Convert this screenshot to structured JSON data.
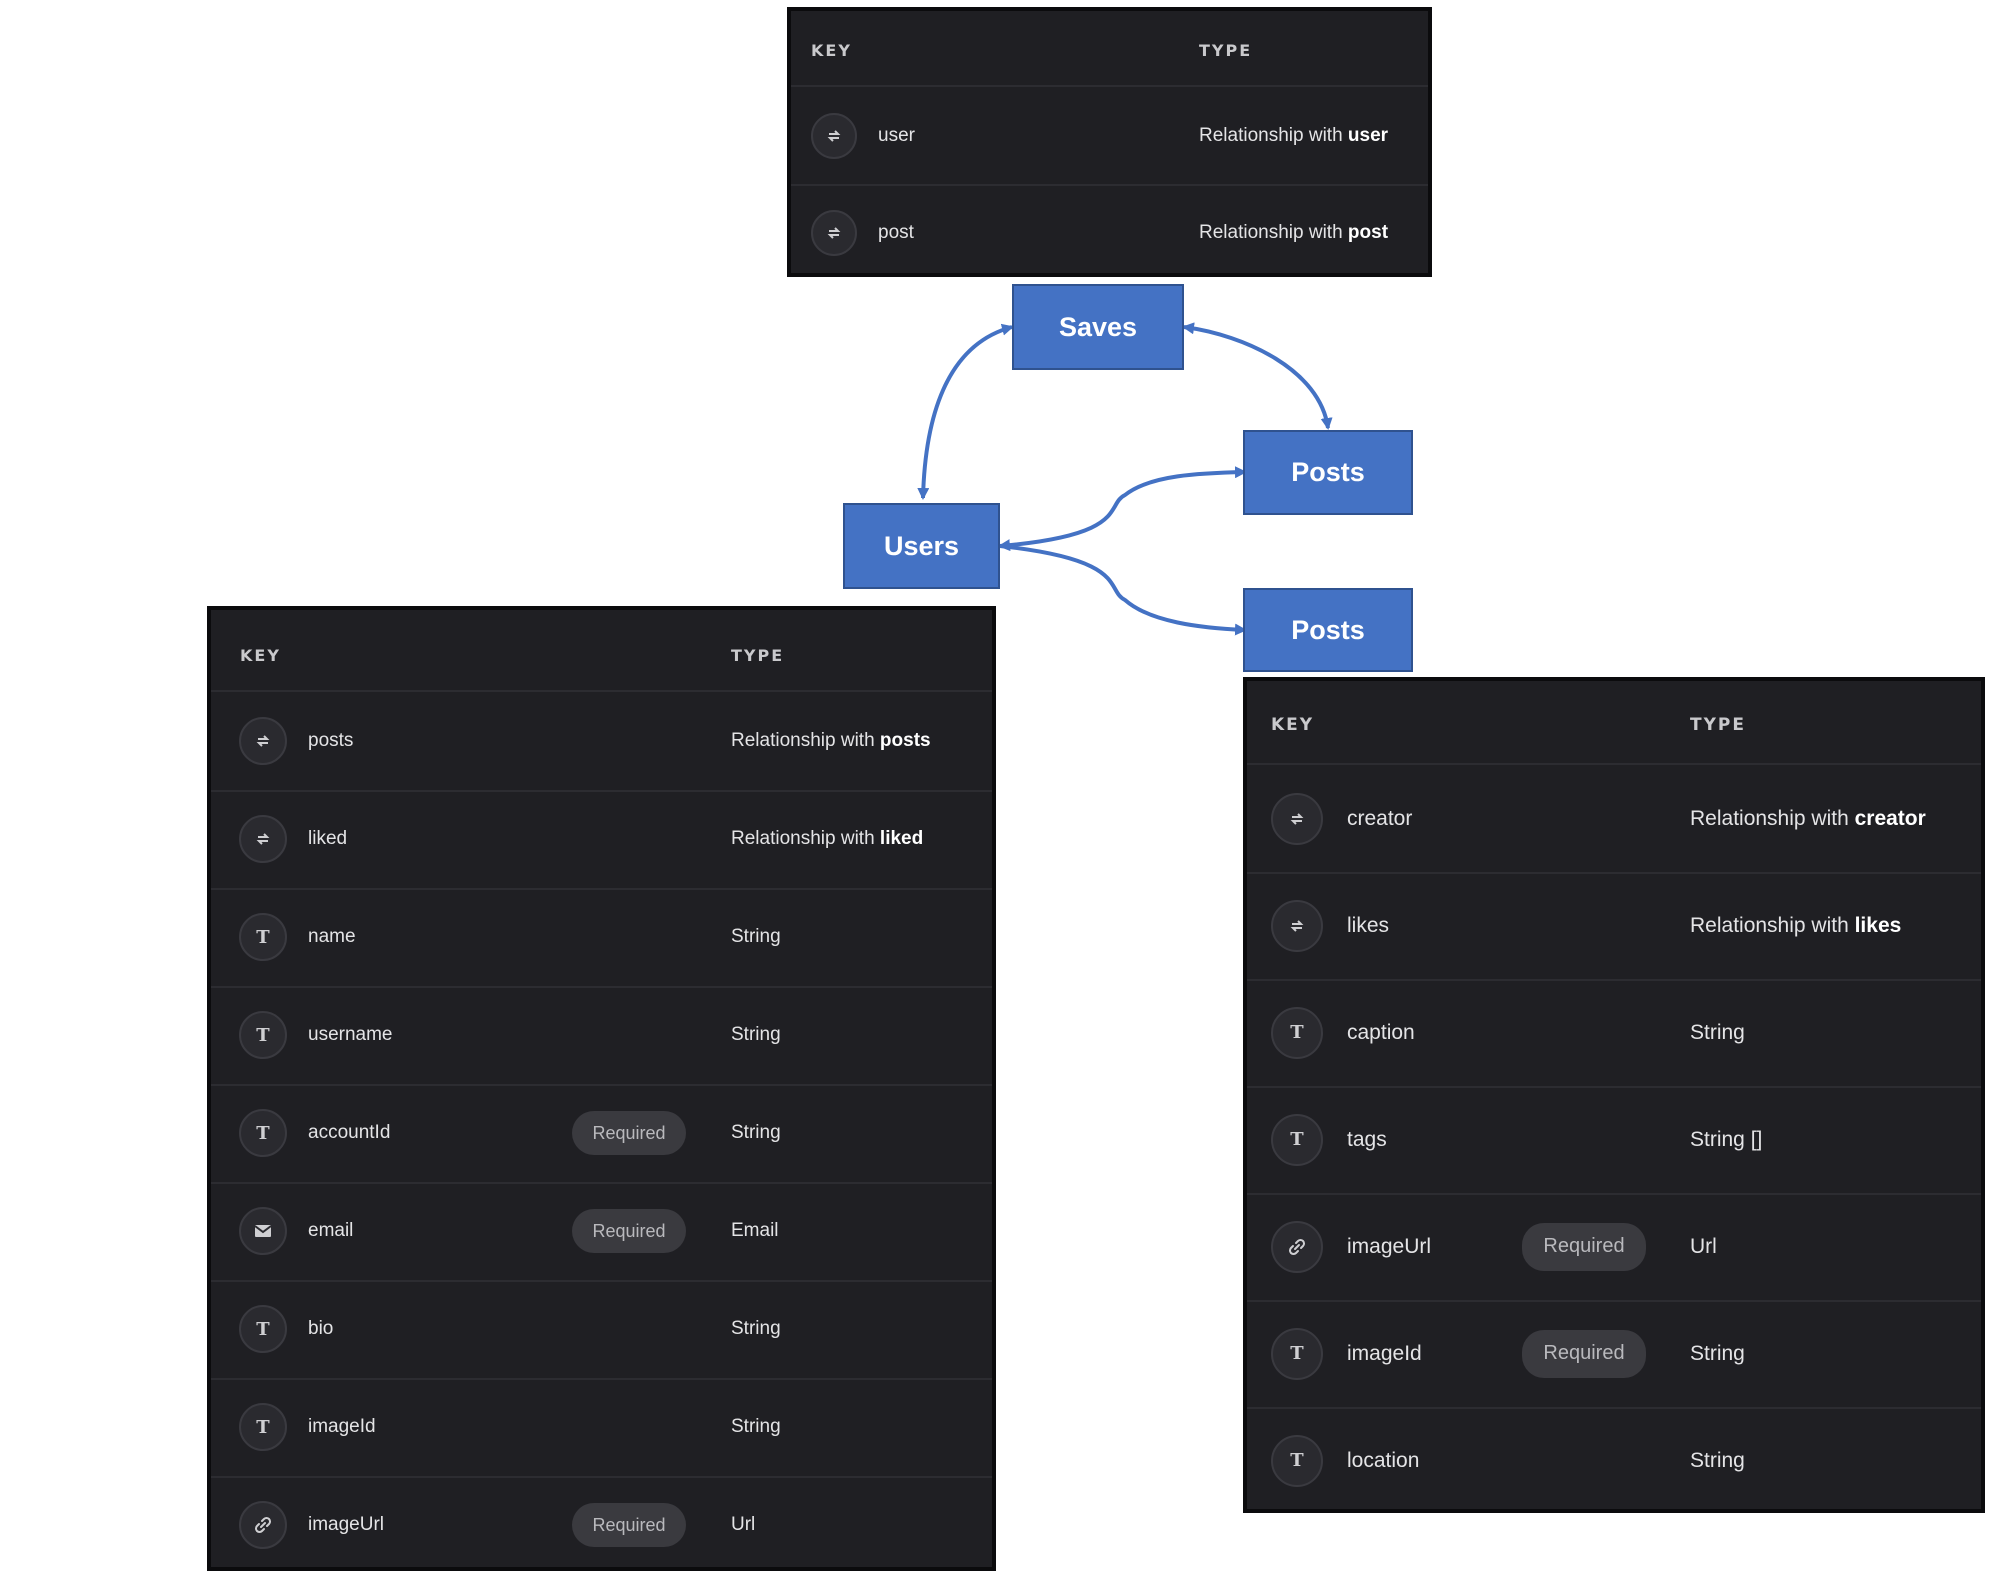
{
  "entities": {
    "saves": "Saves",
    "users": "Users",
    "posts_top": "Posts",
    "posts_bottom": "Posts"
  },
  "saves_table": {
    "header": {
      "key": "KEY",
      "type": "TYPE"
    },
    "rows": [
      {
        "icon": "relationship-icon",
        "key": "user",
        "type_prefix": "Relationship with ",
        "type_bold": "user",
        "required": ""
      },
      {
        "icon": "relationship-icon",
        "key": "post",
        "type_prefix": "Relationship with ",
        "type_bold": "post",
        "required": ""
      }
    ]
  },
  "users_table": {
    "header": {
      "key": "KEY",
      "type": "TYPE"
    },
    "rows": [
      {
        "icon": "relationship-icon",
        "key": "posts",
        "type_prefix": "Relationship with ",
        "type_bold": "posts",
        "required": ""
      },
      {
        "icon": "relationship-icon",
        "key": "liked",
        "type_prefix": "Relationship with ",
        "type_bold": "liked",
        "required": ""
      },
      {
        "icon": "text-icon",
        "key": "name",
        "type_prefix": "String",
        "type_bold": "",
        "required": ""
      },
      {
        "icon": "text-icon",
        "key": "username",
        "type_prefix": "String",
        "type_bold": "",
        "required": ""
      },
      {
        "icon": "text-icon",
        "key": "accountId",
        "type_prefix": "String",
        "type_bold": "",
        "required": "Required"
      },
      {
        "icon": "email-icon",
        "key": "email",
        "type_prefix": "Email",
        "type_bold": "",
        "required": "Required"
      },
      {
        "icon": "text-icon",
        "key": "bio",
        "type_prefix": "String",
        "type_bold": "",
        "required": ""
      },
      {
        "icon": "text-icon",
        "key": "imageId",
        "type_prefix": "String",
        "type_bold": "",
        "required": ""
      },
      {
        "icon": "link-icon",
        "key": "imageUrl",
        "type_prefix": "Url",
        "type_bold": "",
        "required": "Required"
      }
    ]
  },
  "posts_table": {
    "header": {
      "key": "KEY",
      "type": "TYPE"
    },
    "rows": [
      {
        "icon": "relationship-icon",
        "key": "creator",
        "type_prefix": "Relationship with ",
        "type_bold": "creator",
        "required": ""
      },
      {
        "icon": "relationship-icon",
        "key": "likes",
        "type_prefix": "Relationship with ",
        "type_bold": "likes",
        "required": ""
      },
      {
        "icon": "text-icon",
        "key": "caption",
        "type_prefix": "String",
        "type_bold": "",
        "required": ""
      },
      {
        "icon": "text-icon",
        "key": "tags",
        "type_prefix": "String []",
        "type_bold": "",
        "required": ""
      },
      {
        "icon": "link-icon",
        "key": "imageUrl",
        "type_prefix": "Url",
        "type_bold": "",
        "required": "Required"
      },
      {
        "icon": "text-icon",
        "key": "imageId",
        "type_prefix": "String",
        "type_bold": "",
        "required": "Required"
      },
      {
        "icon": "text-icon",
        "key": "location",
        "type_prefix": "String",
        "type_bold": "",
        "required": ""
      }
    ]
  },
  "colors": {
    "entity_fill": "#4472c4",
    "entity_border": "#2f528f",
    "arrow": "#4472c4",
    "panel_bg": "#1f1f23"
  }
}
